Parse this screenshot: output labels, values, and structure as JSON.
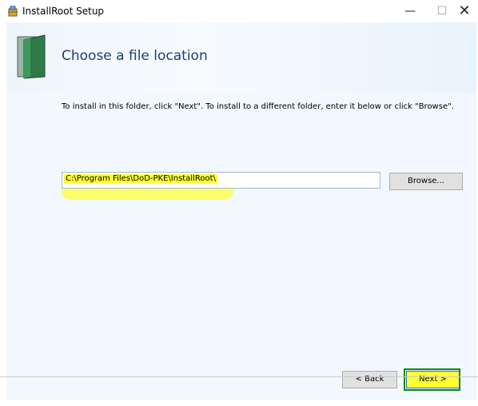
{
  "window": {
    "title": "InstallRoot Setup",
    "minimize_glyph": "—",
    "maximize_glyph": "☐",
    "close_glyph": "✕"
  },
  "page": {
    "heading": "Choose a file location",
    "instructions": "To install in this folder, click \"Next\". To install to a different folder, enter it below or click \"Browse\"."
  },
  "location": {
    "value": "C:\\Program Files\\DoD-PKE\\InstallRoot\\",
    "browse_label": "Browse..."
  },
  "footer": {
    "back_label": "< Back",
    "next_label": "Next >"
  },
  "colors": {
    "heading": "#1e3d7b",
    "highlight": "#ffff33",
    "next_outline": "#0a8a0a"
  }
}
